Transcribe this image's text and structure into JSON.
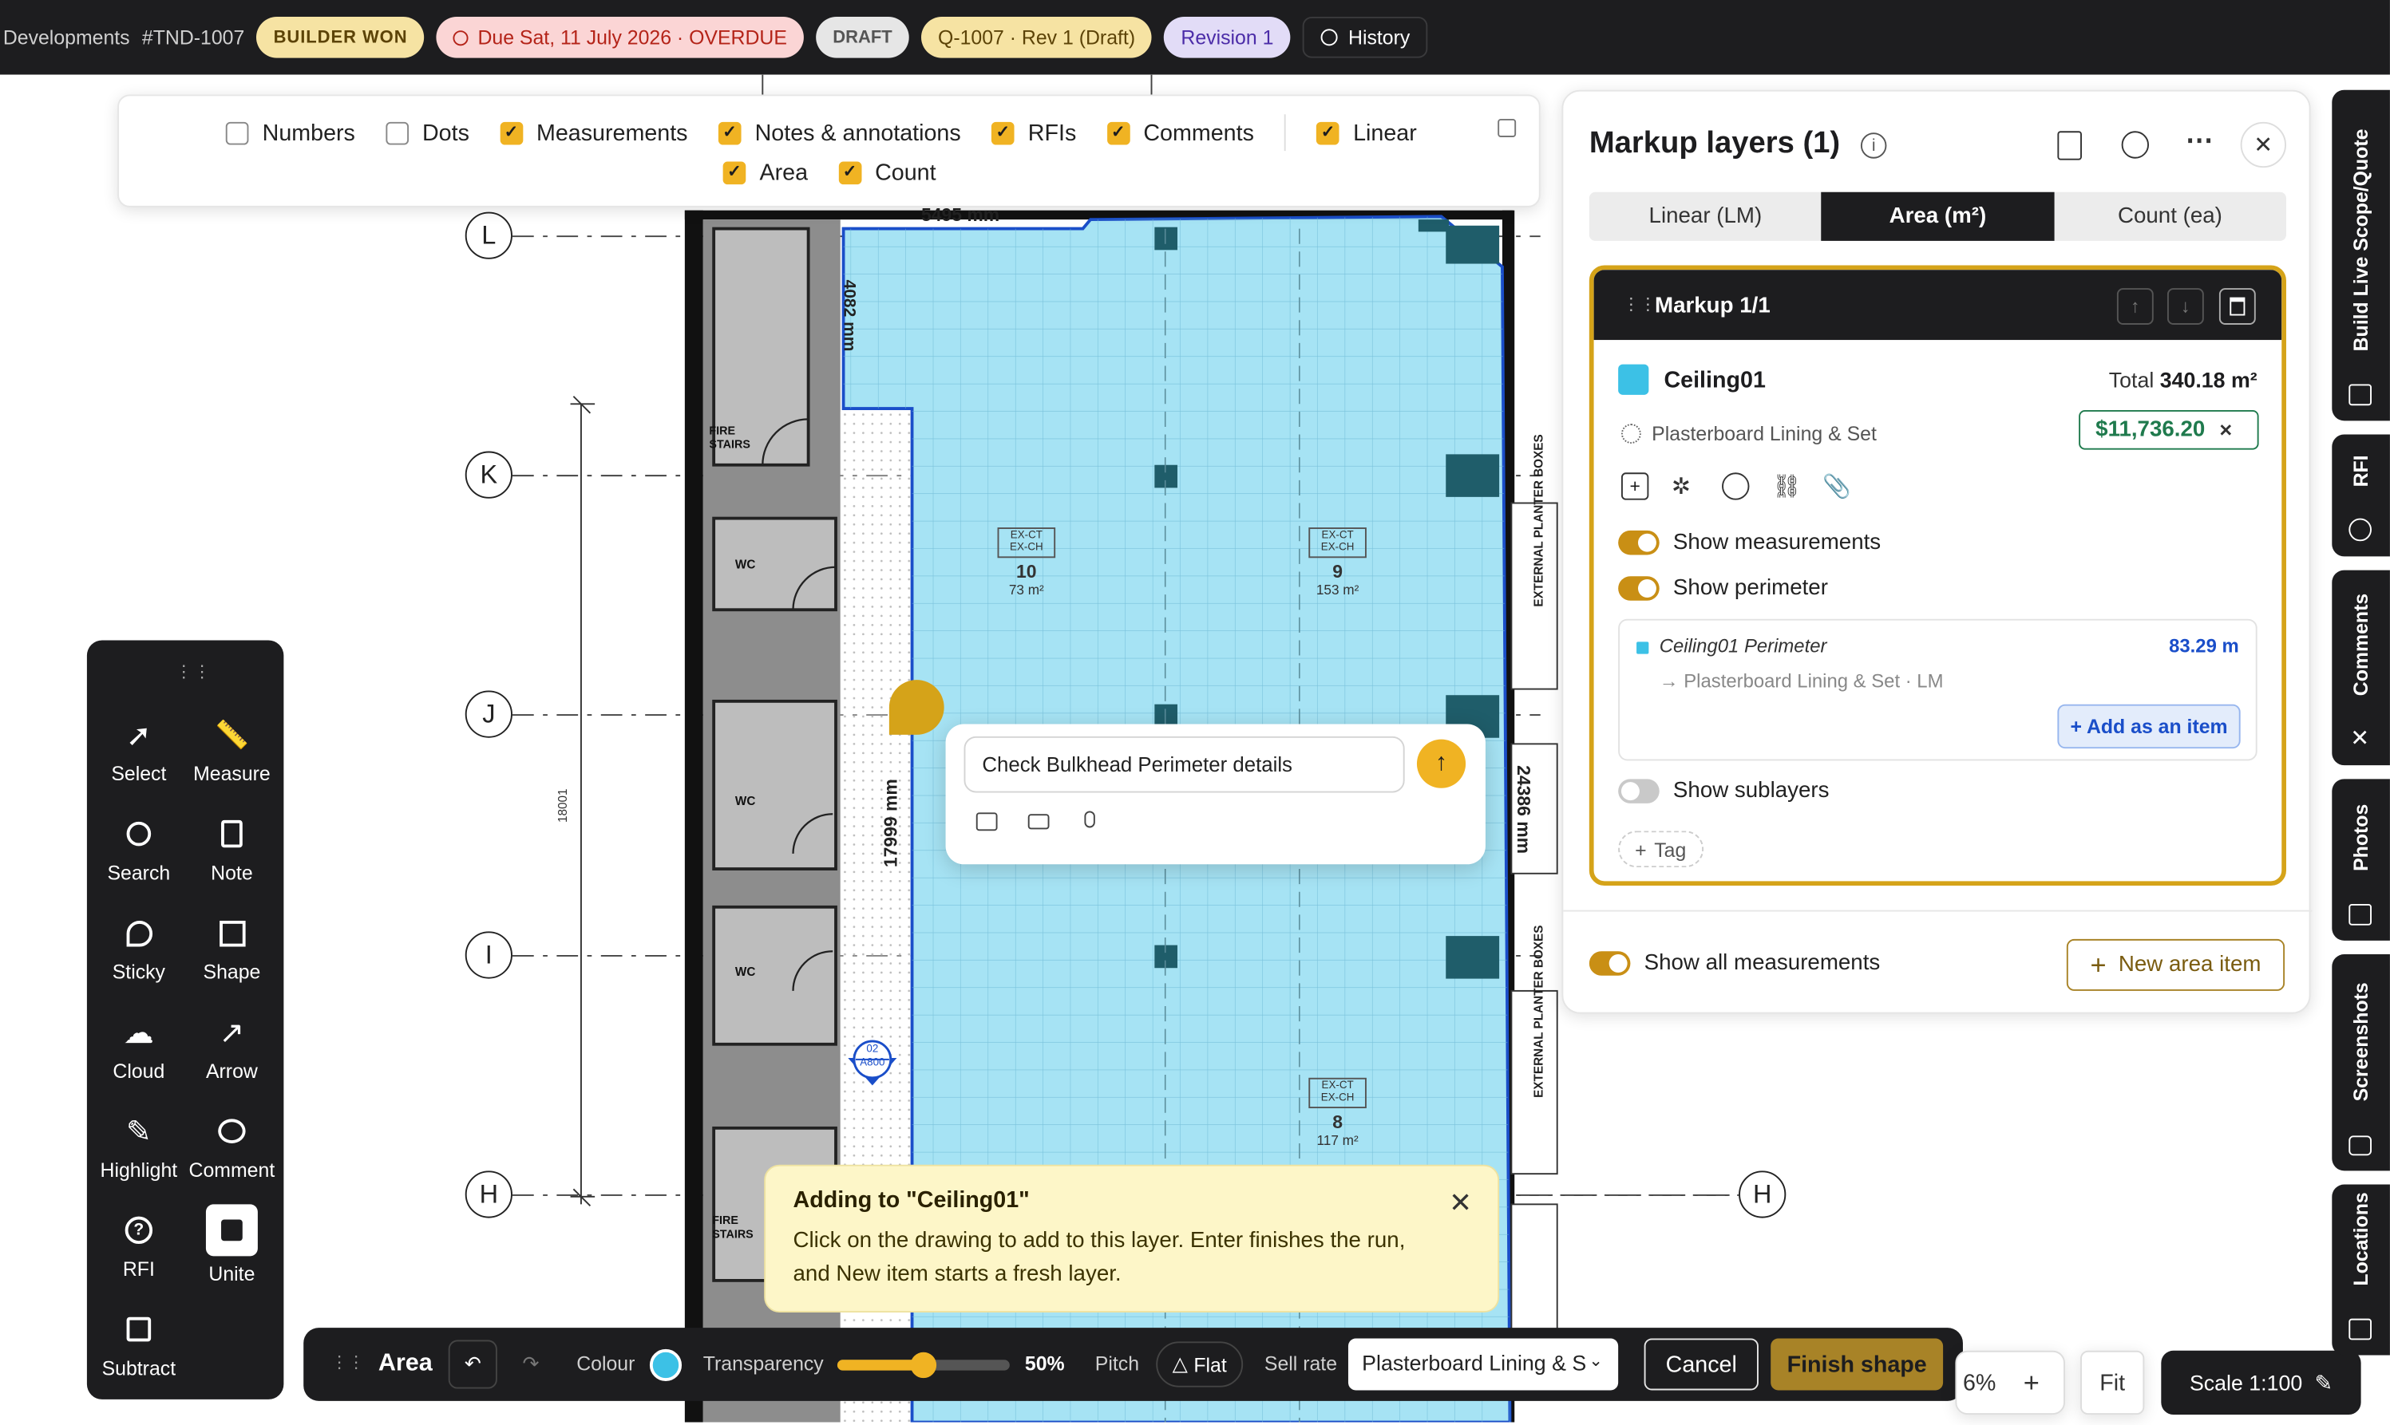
{
  "header": {
    "breadcrumb": "Developments",
    "job_id": "#TND-1007",
    "badges": {
      "builder_won": "BUILDER WON",
      "due": "Due Sat, 11 July 2026 · OVERDUE",
      "draft": "DRAFT",
      "quote": "Q-1007 · Rev 1 (Draft)",
      "revision": "Revision 1",
      "history": "History"
    }
  },
  "layers_bar": {
    "items": [
      {
        "label": "Numbers",
        "checked": false
      },
      {
        "label": "Dots",
        "checked": false
      },
      {
        "label": "Measurements",
        "checked": true
      },
      {
        "label": "Notes & annotations",
        "checked": true
      },
      {
        "label": "RFIs",
        "checked": true
      },
      {
        "label": "Comments",
        "checked": true
      },
      {
        "label": "Linear",
        "checked": true
      },
      {
        "label": "Area",
        "checked": true
      },
      {
        "label": "Count",
        "checked": true
      }
    ]
  },
  "tools": {
    "select": "Select",
    "measure": "Measure",
    "search": "Search",
    "note": "Note",
    "sticky": "Sticky",
    "shape": "Shape",
    "cloud": "Cloud",
    "arrow": "Arrow",
    "highlight": "Highlight",
    "comment": "Comment",
    "rfi": "RFI",
    "unite": "Unite",
    "subtract": "Subtract"
  },
  "drawing": {
    "grid": {
      "L": "L",
      "K": "K",
      "J": "J",
      "I": "I",
      "H": "H",
      "H2": "H"
    },
    "dim_top": "5495 mm",
    "dim_left_small": "4082 mm",
    "dim_mid": "17999 mm",
    "dim_right": "24386 mm",
    "dim_vert_small": "18001",
    "fire_stairs": "FIRE STAIRS",
    "wc": "WC",
    "planter": "EXTERNAL PLANTER BOXES",
    "rooms": [
      {
        "tag": "EX-CT EX-CH",
        "num": "10",
        "area": "73 m²"
      },
      {
        "tag": "EX-CT EX-CH",
        "num": "9",
        "area": "153 m²"
      },
      {
        "tag": "EX-CT EX-CH",
        "num": "8",
        "area": "117 m²"
      }
    ],
    "section_marker": {
      "top": "02",
      "bottom": "A800"
    }
  },
  "comment_popup": {
    "value": "Check Bulkhead Perimeter details"
  },
  "adding_toast": {
    "title": "Adding to \"Ceiling01\"",
    "body": "Click on the drawing to add to this layer. Enter finishes the run, and New item starts a fresh layer."
  },
  "bottom_toolbar": {
    "mode": "Area",
    "colour_label": "Colour",
    "colour": "#3cc1e6",
    "transparency_label": "Transparency",
    "transparency_value": "50%",
    "transparency_level": 0.5,
    "pitch_label": "Pitch",
    "pitch_value": "Flat",
    "sell_rate_label": "Sell rate",
    "sell_rate_value": "Plasterboard Lining & S",
    "cancel": "Cancel",
    "finish": "Finish shape"
  },
  "zoom": {
    "value": "6%",
    "fit": "Fit",
    "scale": "Scale 1:100"
  },
  "markup_panel": {
    "title": "Markup layers (1)",
    "tabs": [
      "Linear (LM)",
      "Area (m²)",
      "Count (ea)"
    ],
    "active_tab": "Area (m²)",
    "markup_header": "Markup 1/1",
    "layer_name": "Ceiling01",
    "layer_color": "#3cc1e6",
    "total_label": "Total",
    "total_value": "340.18 m²",
    "item_name": "Plasterboard Lining & Set",
    "price": "$11,736.20",
    "show_measurements": "Show measurements",
    "show_perimeter": "Show perimeter",
    "perimeter": {
      "name": "Ceiling01 Perimeter",
      "value": "83.29 m",
      "link": "→ Plasterboard Lining & Set · LM",
      "add_button": "+ Add as an item"
    },
    "show_sublayers": "Show sublayers",
    "tag": "Tag",
    "show_all": "Show all measurements",
    "new_item": "New area item"
  },
  "side_tabs": {
    "build": "Build Live Scope/Quote",
    "rfi": "RFI",
    "comments": "Comments",
    "photos": "Photos",
    "screenshots": "Screenshots",
    "locations": "Locations"
  }
}
